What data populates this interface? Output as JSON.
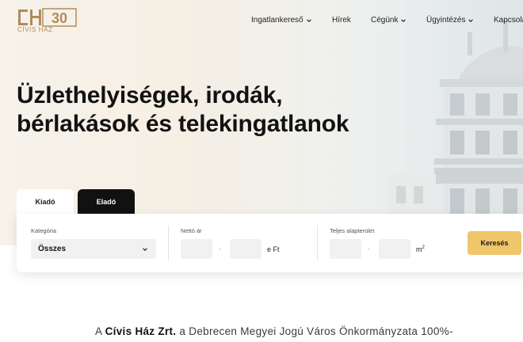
{
  "logo": {
    "mark": "CH",
    "number": "30",
    "subtitle": "CÍVIS HÁZ"
  },
  "nav": {
    "items": [
      {
        "label": "Ingatlankereső"
      },
      {
        "label": "Hírek"
      },
      {
        "label": "Cégünk"
      },
      {
        "label": "Ügyintézés"
      },
      {
        "label": "Kapcsola"
      }
    ]
  },
  "hero": {
    "title": "Üzlethelyiségek, irodák, bérlakások és telekingatlanok"
  },
  "search": {
    "tabs": [
      {
        "label": "Kiadó",
        "active": true
      },
      {
        "label": "Eladó",
        "active": false
      }
    ],
    "category_label": "Kategória",
    "category_value": "Összes",
    "price_label": "Nettó ár",
    "price_sep": "-",
    "price_unit": "e Ft",
    "area_label": "Teljes alapterület",
    "area_sep": "-",
    "area_unit": "m",
    "area_unit_sup": "2",
    "submit_label": "Keresés"
  },
  "intro": {
    "prefix": "A",
    "company": "Cívis Ház Zrt.",
    "rest": "a Debrecen Megyei Jogú Város Önkormányzata 100%-"
  },
  "colors": {
    "accent": "#efc66b",
    "brand_gold": "#b08c5a",
    "dark_tab": "#111111"
  }
}
